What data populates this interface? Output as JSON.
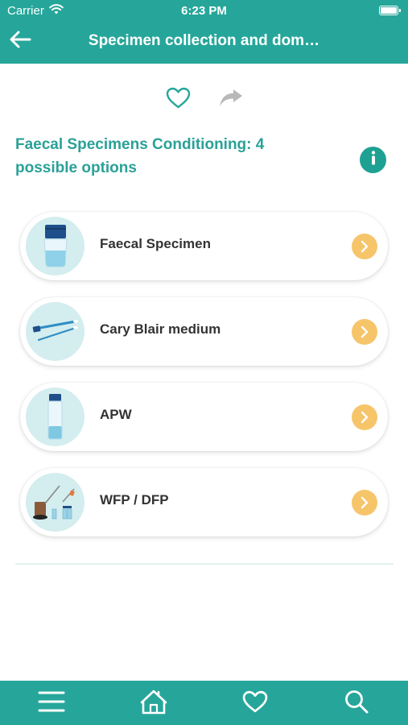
{
  "status_bar": {
    "carrier": "Carrier",
    "time": "6:23 PM"
  },
  "header": {
    "title": "Specimen collection and dom…",
    "back_icon": "arrow-left-icon"
  },
  "actions": {
    "favorite_icon": "heart-outline-icon",
    "share_icon": "share-arrow-icon"
  },
  "section": {
    "title": "Faecal Specimens Conditioning: 4 possible options",
    "info_icon": "info-icon"
  },
  "options": [
    {
      "label": "Faecal Specimen",
      "image": "faecal-container-image"
    },
    {
      "label": "Cary Blair medium",
      "image": "swab-sticks-image"
    },
    {
      "label": "APW",
      "image": "vial-image"
    },
    {
      "label": "WFP / DFP",
      "image": "filter-paper-kit-image"
    }
  ],
  "tabbar": {
    "items": [
      "menu-icon",
      "home-icon",
      "heart-icon",
      "search-icon"
    ]
  },
  "colors": {
    "primary": "#26a69a",
    "section_title": "#2aa197",
    "accent_chevron": "#f6c56a",
    "thumbnail_bg": "#d4edef",
    "text": "#333333"
  }
}
